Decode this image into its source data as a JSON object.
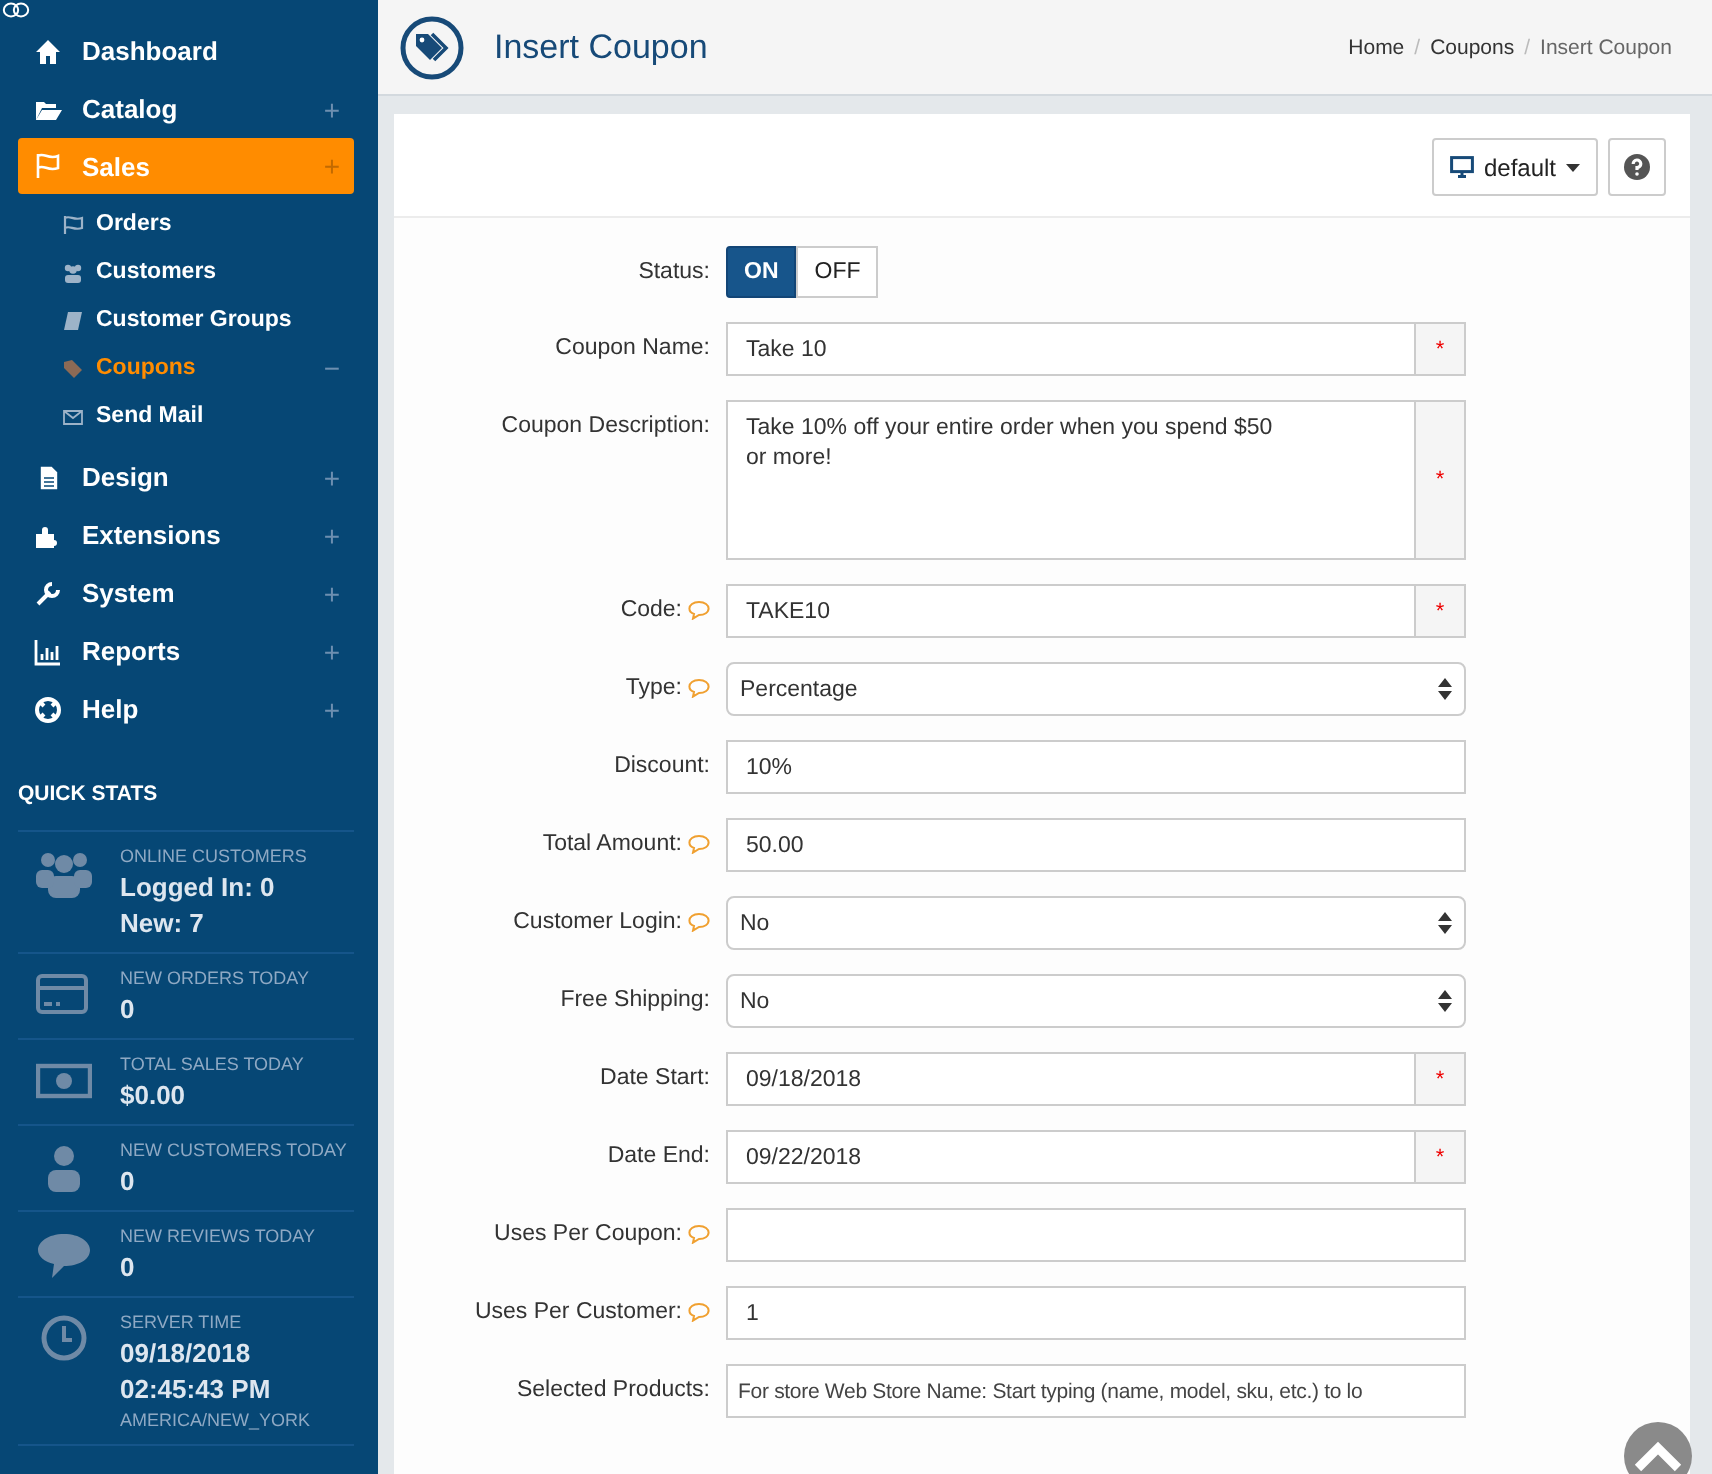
{
  "sidebar": {
    "nav": [
      {
        "label": "Dashboard",
        "selected": false
      },
      {
        "label": "Catalog",
        "selected": false,
        "expander": "+"
      },
      {
        "label": "Sales",
        "selected": true,
        "expander": "+",
        "children": [
          {
            "label": "Orders",
            "selected": false
          },
          {
            "label": "Customers",
            "selected": false
          },
          {
            "label": "Customer Groups",
            "selected": false
          },
          {
            "label": "Coupons",
            "selected": true,
            "expander": "−"
          },
          {
            "label": "Send Mail",
            "selected": false
          }
        ]
      },
      {
        "label": "Design",
        "selected": false,
        "expander": "+"
      },
      {
        "label": "Extensions",
        "selected": false,
        "expander": "+"
      },
      {
        "label": "System",
        "selected": false,
        "expander": "+"
      },
      {
        "label": "Reports",
        "selected": false,
        "expander": "+"
      },
      {
        "label": "Help",
        "selected": false,
        "expander": "+"
      }
    ],
    "quick_stats": {
      "title": "QUICK STATS",
      "items": [
        {
          "label": "ONLINE CUSTOMERS",
          "values": [
            "Logged In: 0",
            "New: 7"
          ]
        },
        {
          "label": "NEW ORDERS TODAY",
          "values": [
            "0"
          ]
        },
        {
          "label": "TOTAL SALES TODAY",
          "values": [
            "$0.00"
          ]
        },
        {
          "label": "NEW CUSTOMERS TODAY",
          "values": [
            "0"
          ]
        },
        {
          "label": "NEW REVIEWS TODAY",
          "values": [
            "0"
          ]
        },
        {
          "label": "SERVER TIME",
          "values": [
            "09/18/2018",
            "02:45:43 PM"
          ],
          "note": "AMERICA/NEW_YORK"
        }
      ]
    }
  },
  "header": {
    "title": "Insert Coupon",
    "separator": "/",
    "breadcrumb": [
      {
        "label": "Home",
        "current": false
      },
      {
        "label": "Coupons",
        "current": false
      },
      {
        "label": "Insert Coupon",
        "current": true
      }
    ]
  },
  "toolbar": {
    "layout_button": "default"
  },
  "form": {
    "fields": [
      {
        "kind": "toggle",
        "label": "Status:",
        "hint": false,
        "options": [
          {
            "label": "ON",
            "selected": true
          },
          {
            "label": "OFF",
            "selected": false
          }
        ]
      },
      {
        "kind": "text",
        "label": "Coupon Name:",
        "hint": false,
        "value": "Take 10",
        "required_mark": "*"
      },
      {
        "kind": "textarea",
        "label": "Coupon Description:",
        "hint": false,
        "value": "Take 10% off your entire order when you spend $50 or more!",
        "required_mark": "*"
      },
      {
        "kind": "text",
        "label": "Code:",
        "hint": true,
        "value": "TAKE10",
        "required_mark": "*"
      },
      {
        "kind": "select",
        "label": "Type:",
        "hint": true,
        "value": "Percentage"
      },
      {
        "kind": "text",
        "label": "Discount:",
        "hint": false,
        "value": "10%"
      },
      {
        "kind": "text",
        "label": "Total Amount:",
        "hint": true,
        "value": "50.00"
      },
      {
        "kind": "select",
        "label": "Customer Login:",
        "hint": true,
        "value": "No"
      },
      {
        "kind": "select",
        "label": "Free Shipping:",
        "hint": false,
        "value": "No"
      },
      {
        "kind": "text",
        "label": "Date Start:",
        "hint": false,
        "value": "09/18/2018",
        "required_mark": "*"
      },
      {
        "kind": "text",
        "label": "Date End:",
        "hint": false,
        "value": "09/22/2018",
        "required_mark": "*"
      },
      {
        "kind": "text",
        "label": "Uses Per Coupon:",
        "hint": true
      },
      {
        "kind": "text",
        "label": "Uses Per Customer:",
        "hint": true,
        "value": "1"
      },
      {
        "kind": "text",
        "label": "Selected Products:",
        "hint": false,
        "placeholder": "For store Web Store Name: Start typing (name, model, sku, etc.) to lo"
      }
    ]
  }
}
